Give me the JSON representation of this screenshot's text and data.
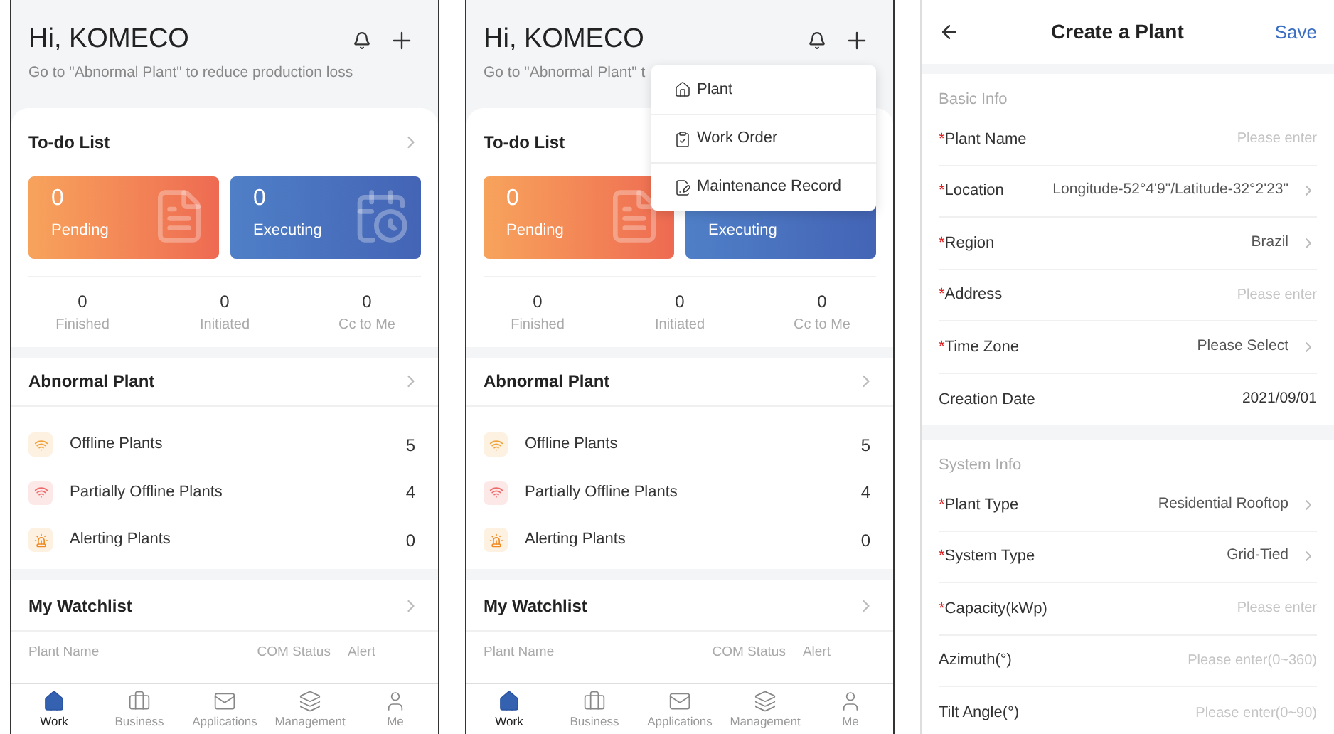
{
  "screens": [
    {
      "kind": "home",
      "greeting": "Hi, KOMECO",
      "subtitle": "Go to \"Abnormal Plant\" to reduce production loss",
      "todo": {
        "title": "To-do List",
        "tiles": [
          {
            "kind": "pending",
            "count": "0",
            "label": "Pending"
          },
          {
            "kind": "executing",
            "count": "0",
            "label": "Executing"
          }
        ],
        "stats": [
          {
            "count": "0",
            "label": "Finished"
          },
          {
            "count": "0",
            "label": "Initiated"
          },
          {
            "count": "0",
            "label": "Cc to Me"
          }
        ]
      },
      "abnormal": {
        "title": "Abnormal Plant",
        "rows": [
          {
            "kind": "offline",
            "label": "Offline Plants",
            "count": "5"
          },
          {
            "kind": "partial",
            "label": "Partially Offline Plants",
            "count": "4"
          },
          {
            "kind": "alerting",
            "label": "Alerting Plants",
            "count": "0"
          }
        ]
      },
      "watchlist": {
        "title": "My Watchlist",
        "columns": [
          "Plant Name",
          "COM Status",
          "Alert"
        ]
      },
      "tabs": [
        {
          "kind": "work",
          "label": "Work",
          "selected": true
        },
        {
          "kind": "business",
          "label": "Business",
          "selected": false
        },
        {
          "kind": "applications",
          "label": "Applications",
          "selected": false
        },
        {
          "kind": "management",
          "label": "Management",
          "selected": false
        },
        {
          "kind": "me",
          "label": "Me",
          "selected": false
        }
      ]
    },
    {
      "kind": "home",
      "greeting": "Hi, KOMECO",
      "subtitle": "Go to \"Abnormal Plant\" t",
      "todo": {
        "title": "To-do List",
        "tiles": [
          {
            "kind": "pending",
            "count": "0",
            "label": "Pending"
          },
          {
            "kind": "executing",
            "label": "Executing"
          }
        ],
        "stats": [
          {
            "count": "0",
            "label": "Finished"
          },
          {
            "count": "0",
            "label": "Initiated"
          },
          {
            "count": "0",
            "label": "Cc to Me"
          }
        ]
      },
      "abnormal": {
        "title": "Abnormal Plant",
        "rows": [
          {
            "kind": "offline",
            "label": "Offline Plants",
            "count": "5"
          },
          {
            "kind": "partial",
            "label": "Partially Offline Plants",
            "count": "4"
          },
          {
            "kind": "alerting",
            "label": "Alerting Plants",
            "count": "0"
          }
        ]
      },
      "watchlist": {
        "title": "My Watchlist",
        "columns": [
          "Plant Name",
          "COM Status",
          "Alert"
        ]
      },
      "menu": [
        {
          "kind": "plant",
          "label": "Plant"
        },
        {
          "kind": "work_order",
          "label": "Work Order"
        },
        {
          "kind": "maintenance",
          "label": "Maintenance Record"
        }
      ],
      "tabs": [
        {
          "kind": "work",
          "label": "Work",
          "selected": true
        },
        {
          "kind": "business",
          "label": "Business",
          "selected": false
        },
        {
          "kind": "applications",
          "label": "Applications",
          "selected": false
        },
        {
          "kind": "management",
          "label": "Management",
          "selected": false
        },
        {
          "kind": "me",
          "label": "Me",
          "selected": false
        }
      ]
    },
    {
      "kind": "form",
      "title": "Create a Plant",
      "action": "Save",
      "sections": [
        {
          "title": "Basic Info",
          "rows": [
            {
              "required_mark": "*",
              "label": "Plant Name",
              "placeholder": "Please enter",
              "chevron": false
            },
            {
              "required_mark": "*",
              "label": "Location",
              "value": "Longitude-52°4'9\"/Latitude-32°2'23\"",
              "chevron": true
            },
            {
              "required_mark": "*",
              "label": "Region",
              "value": "Brazil",
              "chevron": true
            },
            {
              "required_mark": "*",
              "label": "Address",
              "placeholder": "Please enter",
              "chevron": false
            },
            {
              "required_mark": "*",
              "label": "Time Zone",
              "value": "Please Select",
              "chevron": true
            },
            {
              "label": "Creation Date",
              "value": "2021/09/01",
              "chevron": false
            }
          ]
        },
        {
          "title": "System Info",
          "rows": [
            {
              "required_mark": "*",
              "label": "Plant Type",
              "value": "Residential Rooftop",
              "chevron": true
            },
            {
              "required_mark": "*",
              "label": "System Type",
              "value": "Grid-Tied",
              "chevron": true
            },
            {
              "required_mark": "*",
              "label": "Capacity(kWp)",
              "placeholder": "Please enter",
              "chevron": false
            },
            {
              "label": "Azimuth(°)",
              "placeholder": "Please enter(0~360)",
              "chevron": false
            },
            {
              "label": "Tilt Angle(°)",
              "placeholder": "Please enter(0~90)",
              "chevron": false
            }
          ]
        }
      ]
    }
  ]
}
